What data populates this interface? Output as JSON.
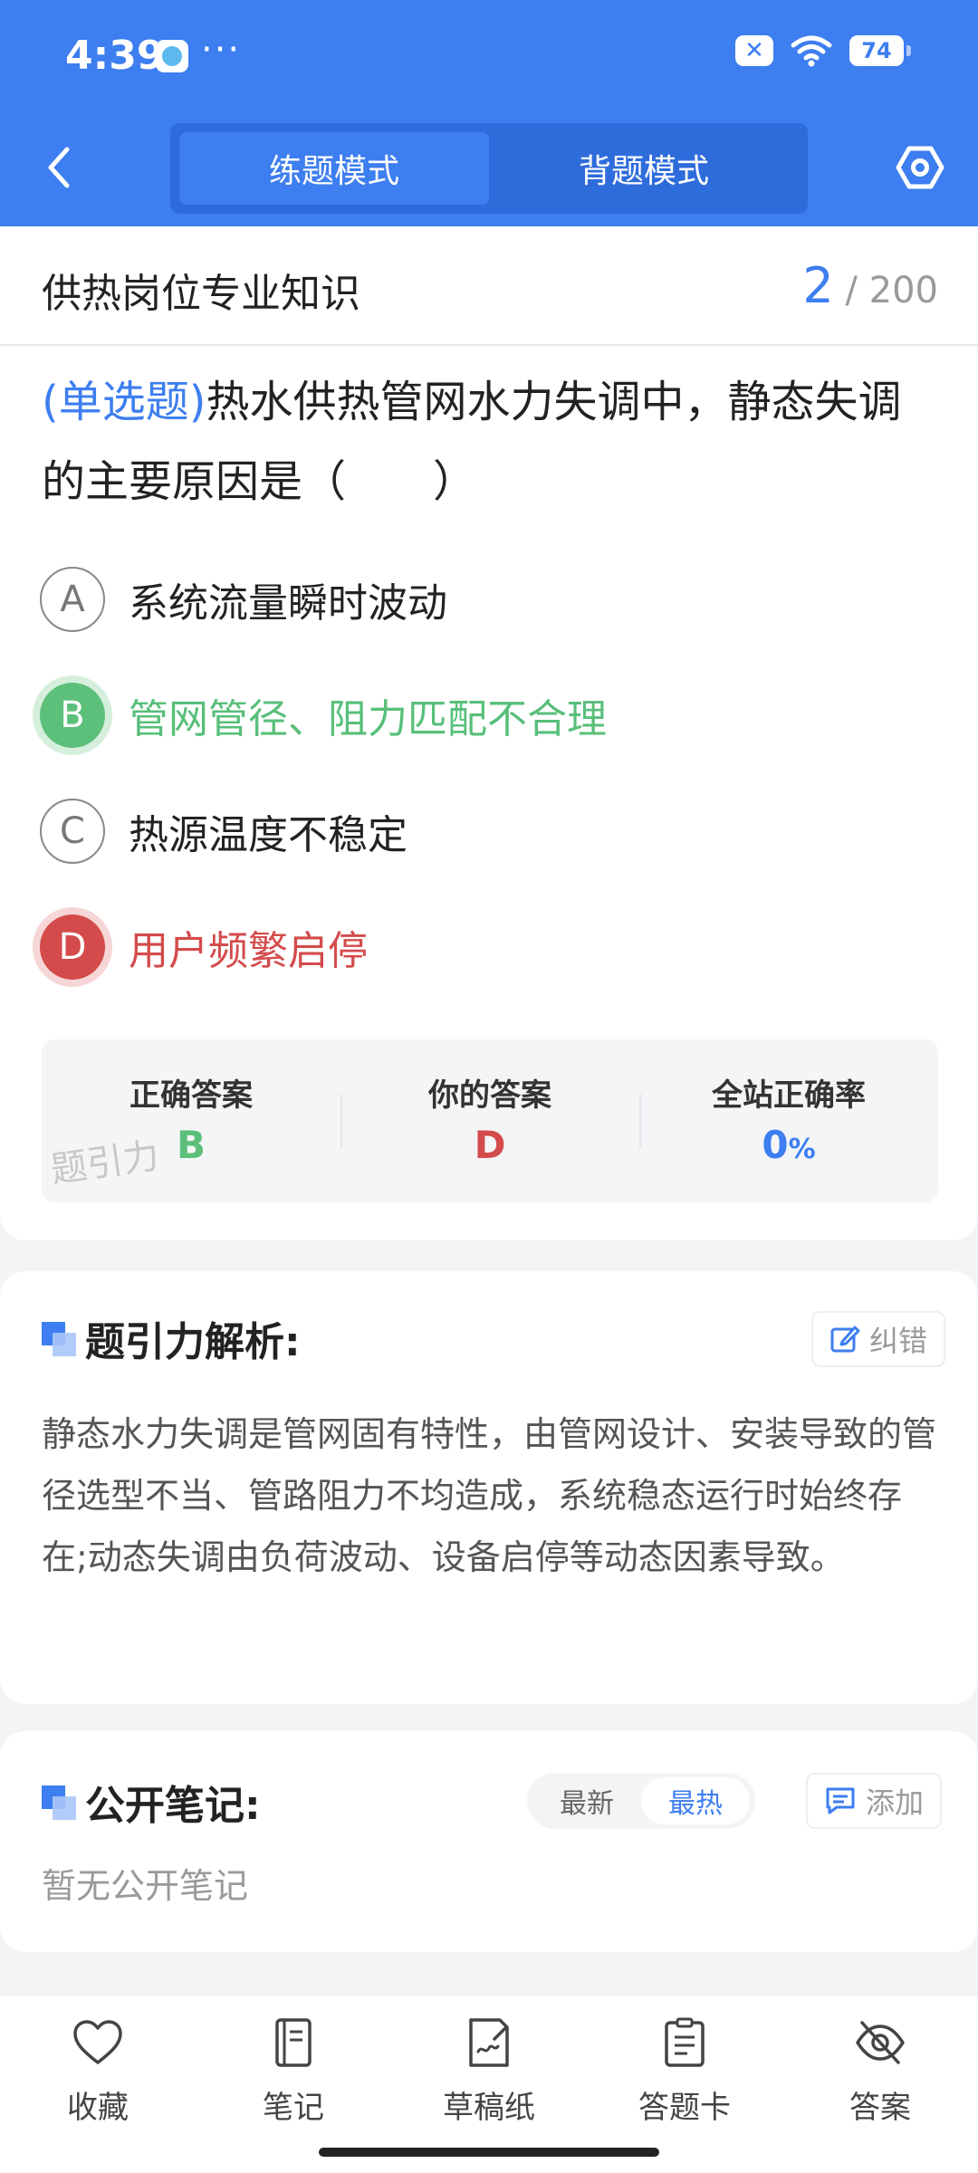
{
  "status_bar": {
    "time": "4:39",
    "more": "···",
    "battery": "74"
  },
  "header": {
    "tabs": [
      {
        "label": "练题模式",
        "active": true
      },
      {
        "label": "背题模式",
        "active": false
      }
    ]
  },
  "question": {
    "subject": "供热岗位专业知识",
    "current": "2",
    "total": "/ 200",
    "type_label": "(单选题)",
    "text": "热水供热管网水力失调中，静态失调的主要原因是（　　）",
    "options": [
      {
        "letter": "A",
        "text": "系统流量瞬时波动",
        "state": "normal"
      },
      {
        "letter": "B",
        "text": "管网管径、阻力匹配不合理",
        "state": "correct"
      },
      {
        "letter": "C",
        "text": "热源温度不稳定",
        "state": "normal"
      },
      {
        "letter": "D",
        "text": "用户频繁启停",
        "state": "wrong"
      }
    ]
  },
  "answer_panel": {
    "correct_label": "正确答案",
    "correct_value": "B",
    "yours_label": "你的答案",
    "yours_value": "D",
    "rate_label": "全站正确率",
    "rate_value": "0",
    "rate_unit": "%",
    "watermark": "题引力"
  },
  "analysis": {
    "title": "题引力解析:",
    "report_label": "纠错",
    "text": "静态水力失调是管网固有特性，由管网设计、安装导致的管径选型不当、管路阻力不均造成，系统稳态运行时始终存在;动态失调由负荷波动、设备启停等动态因素导致。"
  },
  "notes": {
    "title": "公开笔记:",
    "sort_latest": "最新",
    "sort_hot": "最热",
    "add_label": "添加",
    "empty": "暂无公开笔记"
  },
  "bottom_nav": [
    {
      "label": "收藏",
      "icon": "heart-icon"
    },
    {
      "label": "笔记",
      "icon": "notebook-icon"
    },
    {
      "label": "草稿纸",
      "icon": "draft-icon"
    },
    {
      "label": "答题卡",
      "icon": "answer-sheet-icon"
    },
    {
      "label": "答案",
      "icon": "eye-off-icon"
    }
  ],
  "colors": {
    "brand": "#3d7ef0",
    "correct": "#5cc07a",
    "wrong": "#d44b4b"
  }
}
